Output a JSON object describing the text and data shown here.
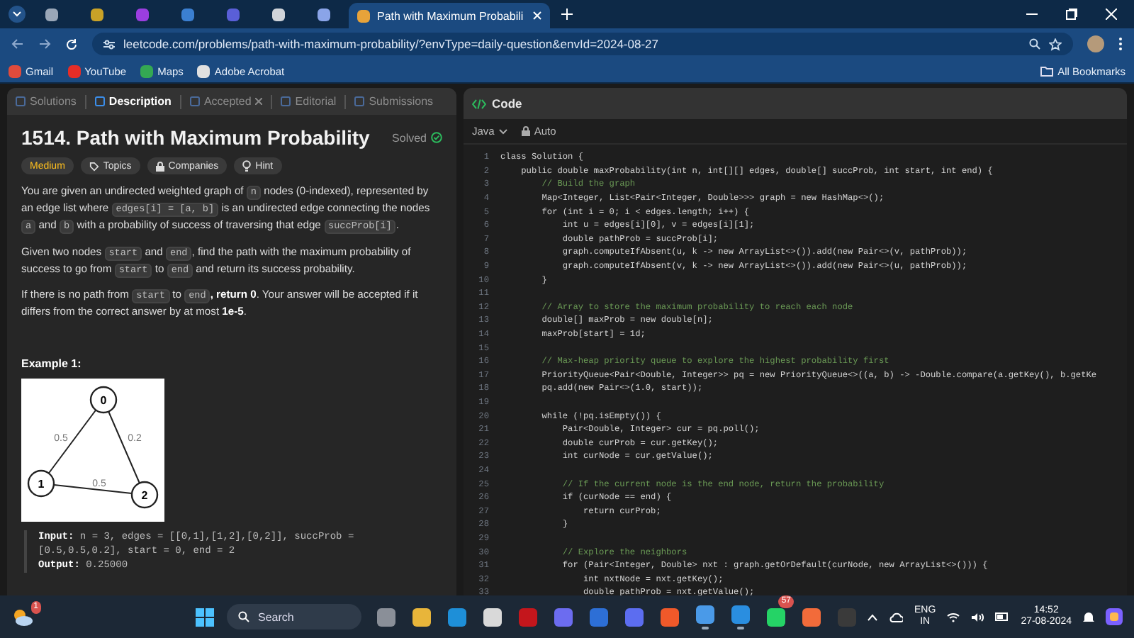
{
  "browser": {
    "tabs": [
      {
        "color": "#9aa7b8",
        "selected": false
      },
      {
        "color": "#c9a227",
        "selected": false
      },
      {
        "color": "#9b3ee0",
        "selected": false
      },
      {
        "color": "#3b7fd1",
        "selected": false
      },
      {
        "color": "#5a5fd8",
        "selected": false
      },
      {
        "color": "#d0d4da",
        "selected": false
      },
      {
        "color": "#8aa4e8",
        "selected": false
      },
      {
        "title": "Path with Maximum Probabili",
        "color": "#e8a33a",
        "selected": true
      }
    ],
    "url": "leetcode.com/problems/path-with-maximum-probability/?envType=daily-question&envId=2024-08-27",
    "bookmarks": [
      {
        "label": "Gmail",
        "color": "#e04b3c"
      },
      {
        "label": "YouTube",
        "color": "#e52d27"
      },
      {
        "label": "Maps",
        "color": "#34a853"
      },
      {
        "label": "Adobe Acrobat",
        "color": "#e0e0e0"
      }
    ],
    "all_bookmarks": "All Bookmarks"
  },
  "problem": {
    "tabs": [
      {
        "label": "Solutions",
        "selected": false
      },
      {
        "label": "Description",
        "selected": true
      },
      {
        "label": "Accepted",
        "selected": false,
        "closable": true
      },
      {
        "label": "Editorial",
        "selected": false
      },
      {
        "label": "Submissions",
        "selected": false
      }
    ],
    "title": "1514. Path with Maximum Probability",
    "status": "Solved",
    "tags": [
      {
        "label": "Medium",
        "kind": "difficulty"
      },
      {
        "label": "Topics",
        "kind": "topics"
      },
      {
        "label": "Companies",
        "kind": "companies"
      },
      {
        "label": "Hint",
        "kind": "hint"
      }
    ],
    "paragraphs": [
      [
        {
          "kind": "text",
          "text": "You are given an undirected weighted graph of "
        },
        {
          "kind": "code",
          "text": "n"
        },
        {
          "kind": "text",
          "text": " nodes (0-indexed), represented by an edge list where "
        },
        {
          "kind": "code",
          "text": "edges[i] = [a, b]"
        },
        {
          "kind": "text",
          "text": " is an undirected edge connecting the nodes "
        },
        {
          "kind": "code",
          "text": "a"
        },
        {
          "kind": "text",
          "text": " and "
        },
        {
          "kind": "code",
          "text": "b"
        },
        {
          "kind": "text",
          "text": " with a probability of success of traversing that edge "
        },
        {
          "kind": "code",
          "text": "succProb[i]"
        },
        {
          "kind": "text",
          "text": "."
        }
      ],
      [
        {
          "kind": "text",
          "text": "Given two nodes "
        },
        {
          "kind": "code",
          "text": "start"
        },
        {
          "kind": "text",
          "text": " and "
        },
        {
          "kind": "code",
          "text": "end"
        },
        {
          "kind": "text",
          "text": ", find the path with the maximum probability of success to go from "
        },
        {
          "kind": "code",
          "text": "start"
        },
        {
          "kind": "text",
          "text": " to "
        },
        {
          "kind": "code",
          "text": "end"
        },
        {
          "kind": "text",
          "text": " and return its success probability."
        }
      ],
      [
        {
          "kind": "text",
          "text": "If there is no path from "
        },
        {
          "kind": "code",
          "text": "start"
        },
        {
          "kind": "text",
          "text": " to "
        },
        {
          "kind": "code",
          "text": "end"
        },
        {
          "kind": "bold",
          "text": ", return 0"
        },
        {
          "kind": "text",
          "text": ". Your answer will be accepted if it differs from the correct answer by at most "
        },
        {
          "kind": "bold",
          "text": "1e-5"
        },
        {
          "kind": "text",
          "text": "."
        }
      ]
    ],
    "example": {
      "title": "Example 1:",
      "graph": {
        "nodes": [
          "0",
          "1",
          "2"
        ],
        "edges": [
          {
            "label": "0.5"
          },
          {
            "label": "0.5"
          },
          {
            "label": "0.2"
          }
        ]
      },
      "input_label": "Input:",
      "input": "n = 3, edges = [[0,1],[1,2],[0,2]], succProb = [0.5,0.5,0.2], start = 0, end = 2",
      "output_label": "Output:",
      "output": "0.25000"
    }
  },
  "code": {
    "title": "Code",
    "language": "Java",
    "mode": "Auto",
    "lines": [
      {
        "number": "1",
        "kind": "code",
        "text": "class Solution {"
      },
      {
        "number": "2",
        "kind": "code",
        "text": "    public double maxProbability(int n, int[][] edges, double[] succProb, int start, int end) {"
      },
      {
        "number": "3",
        "kind": "comment",
        "text": "        // Build the graph"
      },
      {
        "number": "4",
        "kind": "code",
        "text": "        Map<Integer, List<Pair<Integer, Double>>> graph = new HashMap<>();"
      },
      {
        "number": "5",
        "kind": "code",
        "text": "        for (int i = 0; i < edges.length; i++) {"
      },
      {
        "number": "6",
        "kind": "code",
        "text": "            int u = edges[i][0], v = edges[i][1];"
      },
      {
        "number": "7",
        "kind": "code",
        "text": "            double pathProb = succProb[i];"
      },
      {
        "number": "8",
        "kind": "code",
        "text": "            graph.computeIfAbsent(u, k -> new ArrayList<>()).add(new Pair<>(v, pathProb));"
      },
      {
        "number": "9",
        "kind": "code",
        "text": "            graph.computeIfAbsent(v, k -> new ArrayList<>()).add(new Pair<>(u, pathProb));"
      },
      {
        "number": "10",
        "kind": "code",
        "text": "        }"
      },
      {
        "number": "11"
      },
      {
        "number": "12",
        "kind": "comment",
        "text": "        // Array to store the maximum probability to reach each node"
      },
      {
        "number": "13",
        "kind": "code",
        "text": "        double[] maxProb = new double[n];"
      },
      {
        "number": "14",
        "kind": "code",
        "text": "        maxProb[start] = 1d;"
      },
      {
        "number": "15"
      },
      {
        "number": "16",
        "kind": "comment",
        "text": "        // Max-heap priority queue to explore the highest probability first"
      },
      {
        "number": "17",
        "kind": "code",
        "text": "        PriorityQueue<Pair<Double, Integer>> pq = new PriorityQueue<>((a, b) -> -Double.compare(a.getKey(), b.getKe"
      },
      {
        "number": "18",
        "kind": "code",
        "text": "        pq.add(new Pair<>(1.0, start));"
      },
      {
        "number": "19"
      },
      {
        "number": "20",
        "kind": "code",
        "text": "        while (!pq.isEmpty()) {"
      },
      {
        "number": "21",
        "kind": "code",
        "text": "            Pair<Double, Integer> cur = pq.poll();"
      },
      {
        "number": "22",
        "kind": "code",
        "text": "            double curProb = cur.getKey();"
      },
      {
        "number": "23",
        "kind": "code",
        "text": "            int curNode = cur.getValue();"
      },
      {
        "number": "24"
      },
      {
        "number": "25",
        "kind": "comment",
        "text": "            // If the current node is the end node, return the probability"
      },
      {
        "number": "26",
        "kind": "code",
        "text": "            if (curNode == end) {"
      },
      {
        "number": "27",
        "kind": "code",
        "text": "                return curProb;"
      },
      {
        "number": "28",
        "kind": "code",
        "text": "            }"
      },
      {
        "number": "29"
      },
      {
        "number": "30",
        "kind": "comment",
        "text": "            // Explore the neighbors"
      },
      {
        "number": "31",
        "kind": "code",
        "text": "            for (Pair<Integer, Double> nxt : graph.getOrDefault(curNode, new ArrayList<>())) {"
      },
      {
        "number": "32",
        "kind": "code",
        "text": "                int nxtNode = nxt.getKey();"
      },
      {
        "number": "33",
        "kind": "code",
        "text": "                double pathProb = nxt.getValue();"
      }
    ]
  },
  "taskbar": {
    "weather_badge": "1",
    "search": "Search",
    "apps": [
      {
        "color": "#8a8f98",
        "running": false
      },
      {
        "color": "#e8b53a",
        "running": false
      },
      {
        "color": "#1e8fd8",
        "running": false
      },
      {
        "color": "#d9d9d9",
        "running": false
      },
      {
        "color": "#c4161c",
        "running": false
      },
      {
        "color": "#6c6cf0",
        "running": false
      },
      {
        "color": "#2d6fd6",
        "running": false
      },
      {
        "color": "#5c6df0",
        "running": false
      },
      {
        "color": "#f0592a",
        "running": false
      },
      {
        "color": "#4a9ae8",
        "running": true
      },
      {
        "color": "#2a8ee0",
        "running": true
      },
      {
        "color": "#25d366",
        "running": false,
        "badge": "57"
      },
      {
        "color": "#f26b3a",
        "running": false
      },
      {
        "color": "#3a3a3a",
        "running": false
      }
    ],
    "language": "ENG",
    "region": "IN",
    "time": "14:52",
    "date": "27-08-2024"
  }
}
